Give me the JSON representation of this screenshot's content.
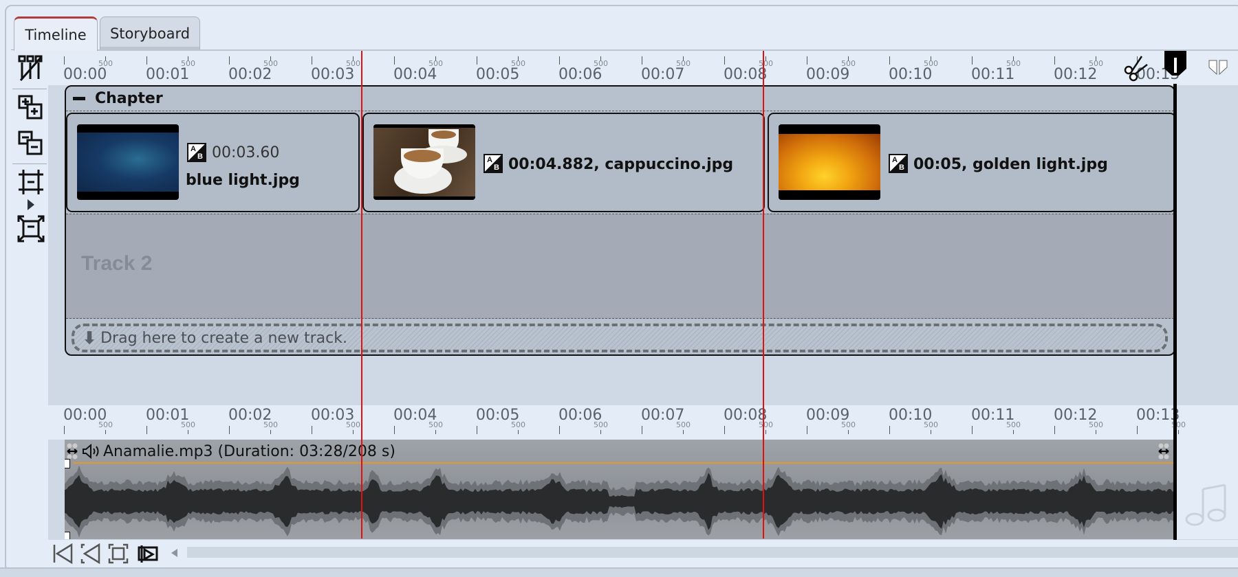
{
  "tabs": [
    {
      "label": "Timeline",
      "active": true
    },
    {
      "label": "Storyboard",
      "active": false
    }
  ],
  "left_toolbar": [
    {
      "icon": "remove-chapters-icon"
    },
    {
      "icon": "add-chapter-icon"
    },
    {
      "icon": "remove-chapter-icon"
    },
    {
      "icon": "collapse-tracks-icon"
    },
    {
      "icon": "expand-menu-triangle-icon"
    },
    {
      "icon": "expand-tracks-icon"
    }
  ],
  "ruler": {
    "seconds": [
      "00:00",
      "00:01",
      "00:02",
      "00:03",
      "00:04",
      "00:05",
      "00:06",
      "00:07",
      "00:08",
      "00:09",
      "00:10",
      "00:11",
      "00:12",
      "00:13"
    ],
    "half_label": "500"
  },
  "chapter": {
    "title": "Chapter",
    "collapse_icon": "minus-icon"
  },
  "clips": [
    {
      "duration": "00:03.60",
      "name": "blue light.jpg",
      "transition_icon": "ab-transition-icon"
    },
    {
      "label": "00:04.882, cappuccino.jpg",
      "duration": "00:04.882",
      "name": "cappuccino.jpg",
      "transition_icon": "ab-transition-icon"
    },
    {
      "label": "00:05, golden light.jpg",
      "duration": "00:05",
      "name": "golden light.jpg",
      "transition_icon": "ab-transition-icon"
    }
  ],
  "track2": {
    "label": "Track 2"
  },
  "dropzone": {
    "label": "Drag here to create a new track."
  },
  "audio": {
    "title": "Anamalie.mp3 (Duration: 03:28/208 s)",
    "volume_icon": "speaker-icon"
  },
  "bottom_toolbar": [
    {
      "icon": "go-to-start-icon"
    },
    {
      "icon": "previous-marker-icon"
    },
    {
      "icon": "fit-to-view-icon"
    },
    {
      "icon": "play-preview-icon"
    }
  ],
  "colors": {
    "marker": "#e01010",
    "tab_accent": "#b33a3a",
    "volume_line": "#e8952a"
  }
}
